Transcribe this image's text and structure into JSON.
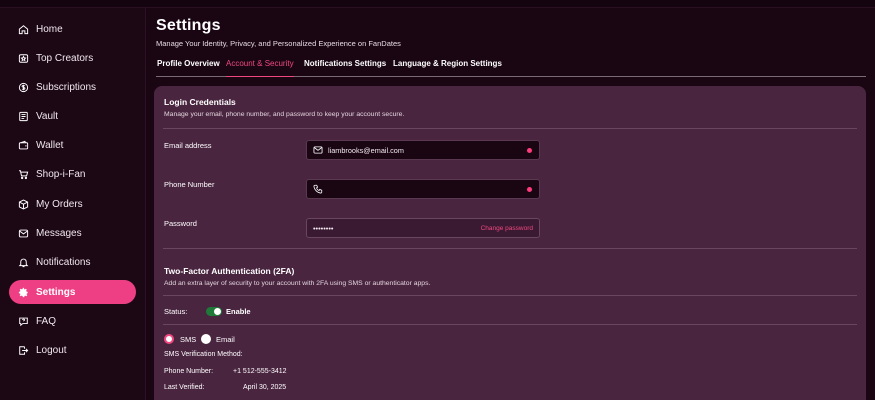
{
  "sidebar": {
    "items": [
      {
        "label": "Home",
        "icon": "home-icon"
      },
      {
        "label": "Top Creators",
        "icon": "star-icon"
      },
      {
        "label": "Subscriptions",
        "icon": "subscription-icon"
      },
      {
        "label": "Vault",
        "icon": "vault-icon"
      },
      {
        "label": "Wallet",
        "icon": "wallet-icon"
      },
      {
        "label": "Shop-i-Fan",
        "icon": "cart-icon"
      },
      {
        "label": "My Orders",
        "icon": "orders-icon"
      },
      {
        "label": "Messages",
        "icon": "message-icon"
      },
      {
        "label": "Notifications",
        "icon": "bell-icon"
      },
      {
        "label": "Settings",
        "icon": "gear-icon",
        "active": true
      },
      {
        "label": "FAQ",
        "icon": "faq-icon"
      },
      {
        "label": "Logout",
        "icon": "logout-icon"
      }
    ]
  },
  "header": {
    "title": "Settings",
    "subtitle": "Manage Your Identity, Privacy, and Personalized Experience on FanDates"
  },
  "tabs": [
    {
      "label": "Profile Overview"
    },
    {
      "label": "Account & Security",
      "active": true
    },
    {
      "label": "Notifications Settings"
    },
    {
      "label": "Language & Region Settings"
    }
  ],
  "login": {
    "title": "Login Credentials",
    "description": "Manage your email, phone number, and password to keep your account secure.",
    "email_label": "Email address",
    "email_value": "liambrooks@email.com",
    "phone_label": "Phone Number",
    "phone_value": "",
    "password_label": "Password",
    "password_value": "••••••••",
    "change_password": "Change password"
  },
  "twofa": {
    "title": "Two-Factor Authentication (2FA)",
    "description": "Add an extra layer of security to your account with 2FA using SMS or authenticator apps.",
    "status_label": "Status:",
    "toggle_label": "Enable",
    "enabled": true,
    "option_sms": "SMS",
    "option_email": "Email",
    "method_label": "SMS Verification Method:",
    "phone_label": "Phone Number:",
    "phone_value": "+1 512-555-3412",
    "verified_label": "Last Verified:",
    "verified_value": "April 30, 2025"
  },
  "colors": {
    "accent": "#ee3f85",
    "background": "#1a0613",
    "card": "#4a2540",
    "toggle_on": "#1f7a3a"
  }
}
